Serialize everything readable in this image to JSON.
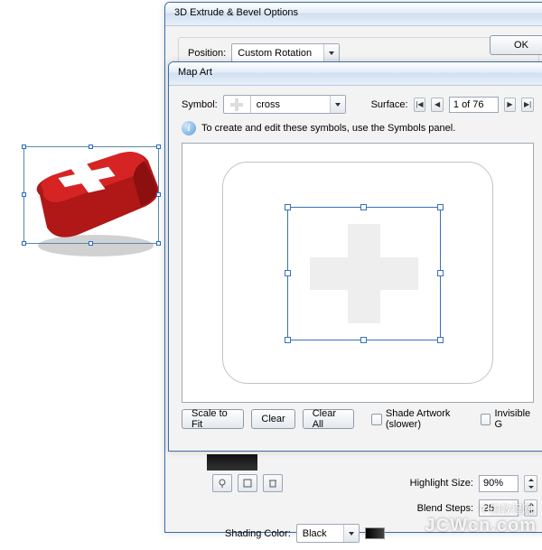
{
  "parentDialog": {
    "title": "3D Extrude & Bevel Options",
    "position_label": "Position:",
    "position_value": "Custom Rotation",
    "ok_label": "OK",
    "highlight_label": "Highlight Size:",
    "highlight_value": "90%",
    "blend_label": "Blend Steps:",
    "blend_value": "25",
    "shading_label": "Shading Color:",
    "shading_value": "Black"
  },
  "mapArt": {
    "title": "Map Art",
    "symbol_label": "Symbol:",
    "symbol_value": "cross",
    "surface_label": "Surface:",
    "surface_value": "1 of 76",
    "hint": "To create and edit these symbols, use the Symbols panel.",
    "scale_btn": "Scale to Fit",
    "clear_btn": "Clear",
    "clearall_btn": "Clear All",
    "shade_chk": "Shade Artwork (slower)",
    "invisible_chk": "Invisible G"
  },
  "watermark": {
    "cn": "中国教程网",
    "url": "JCWcn.com"
  }
}
